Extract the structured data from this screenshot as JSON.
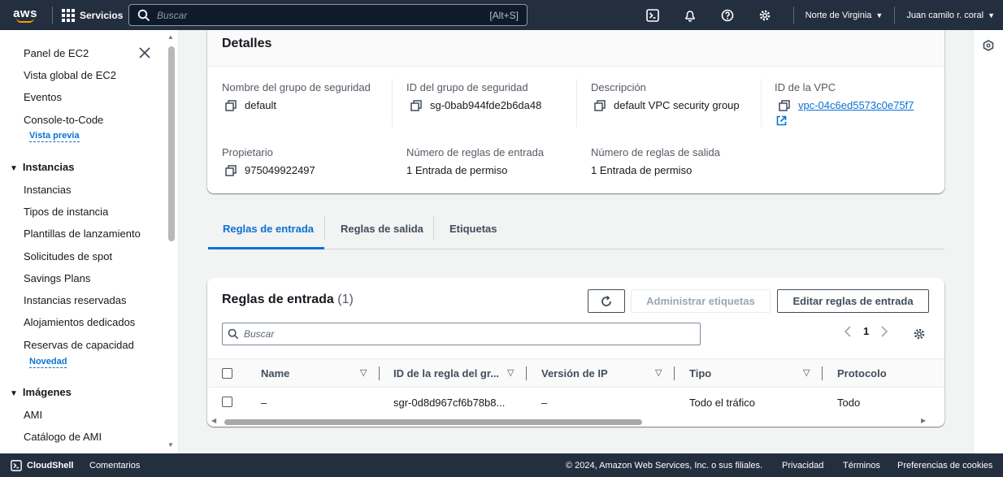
{
  "topnav": {
    "logo": "aws",
    "services": "Servicios",
    "search_placeholder": "Buscar",
    "search_shortcut": "[Alt+S]",
    "region": "Norte de Virginia",
    "user": "Juan camilo r. coral"
  },
  "sidebar": {
    "items": [
      {
        "label": "Panel de EC2"
      },
      {
        "label": "Vista global de EC2"
      },
      {
        "label": "Eventos"
      },
      {
        "label": "Console-to-Code"
      }
    ],
    "preview_badge": "Vista previa",
    "section_instances": "Instancias",
    "instance_items": [
      "Instancias",
      "Tipos de instancia",
      "Plantillas de lanzamiento",
      "Solicitudes de spot",
      "Savings Plans",
      "Instancias reservadas",
      "Alojamientos dedicados",
      "Reservas de capacidad"
    ],
    "new_badge": "Novedad",
    "section_images": "Imágenes",
    "image_items": [
      "AMI",
      "Catálogo de AMI"
    ]
  },
  "details": {
    "title": "Detalles",
    "fields": {
      "sg_name_label": "Nombre del grupo de seguridad",
      "sg_name": "default",
      "sg_id_label": "ID del grupo de seguridad",
      "sg_id": "sg-0bab944fde2b6da48",
      "desc_label": "Descripción",
      "desc": "default VPC security group",
      "vpc_label": "ID de la VPC",
      "vpc": "vpc-04c6ed5573c0e75f7",
      "owner_label": "Propietario",
      "owner": "975049922497",
      "inbound_count_label": "Número de reglas de entrada",
      "inbound_count": "1 Entrada de permiso",
      "outbound_count_label": "Número de reglas de salida",
      "outbound_count": "1 Entrada de permiso"
    }
  },
  "tabs": [
    "Reglas de entrada",
    "Reglas de salida",
    "Etiquetas"
  ],
  "rules": {
    "title": "Reglas de entrada",
    "count": "(1)",
    "btn_manage_tags": "Administrar etiquetas",
    "btn_edit_rules": "Editar reglas de entrada",
    "search_placeholder": "Buscar",
    "page": "1",
    "columns": [
      "Name",
      "ID de la regla del gr...",
      "Versión de IP",
      "Tipo",
      "Protocolo"
    ],
    "rows": [
      {
        "name": "–",
        "rule_id": "sgr-0d8d967cf6b78b8...",
        "ip_version": "–",
        "type": "Todo el tráfico",
        "protocol": "Todo"
      }
    ]
  },
  "footer": {
    "cloudshell": "CloudShell",
    "feedback": "Comentarios",
    "copyright": "© 2024, Amazon Web Services, Inc. o sus filiales.",
    "privacy": "Privacidad",
    "terms": "Términos",
    "cookies": "Preferencias de cookies"
  },
  "colors": {
    "nav_bg": "#232f3e",
    "accent": "#0972d3",
    "smile": "#ff9900"
  }
}
